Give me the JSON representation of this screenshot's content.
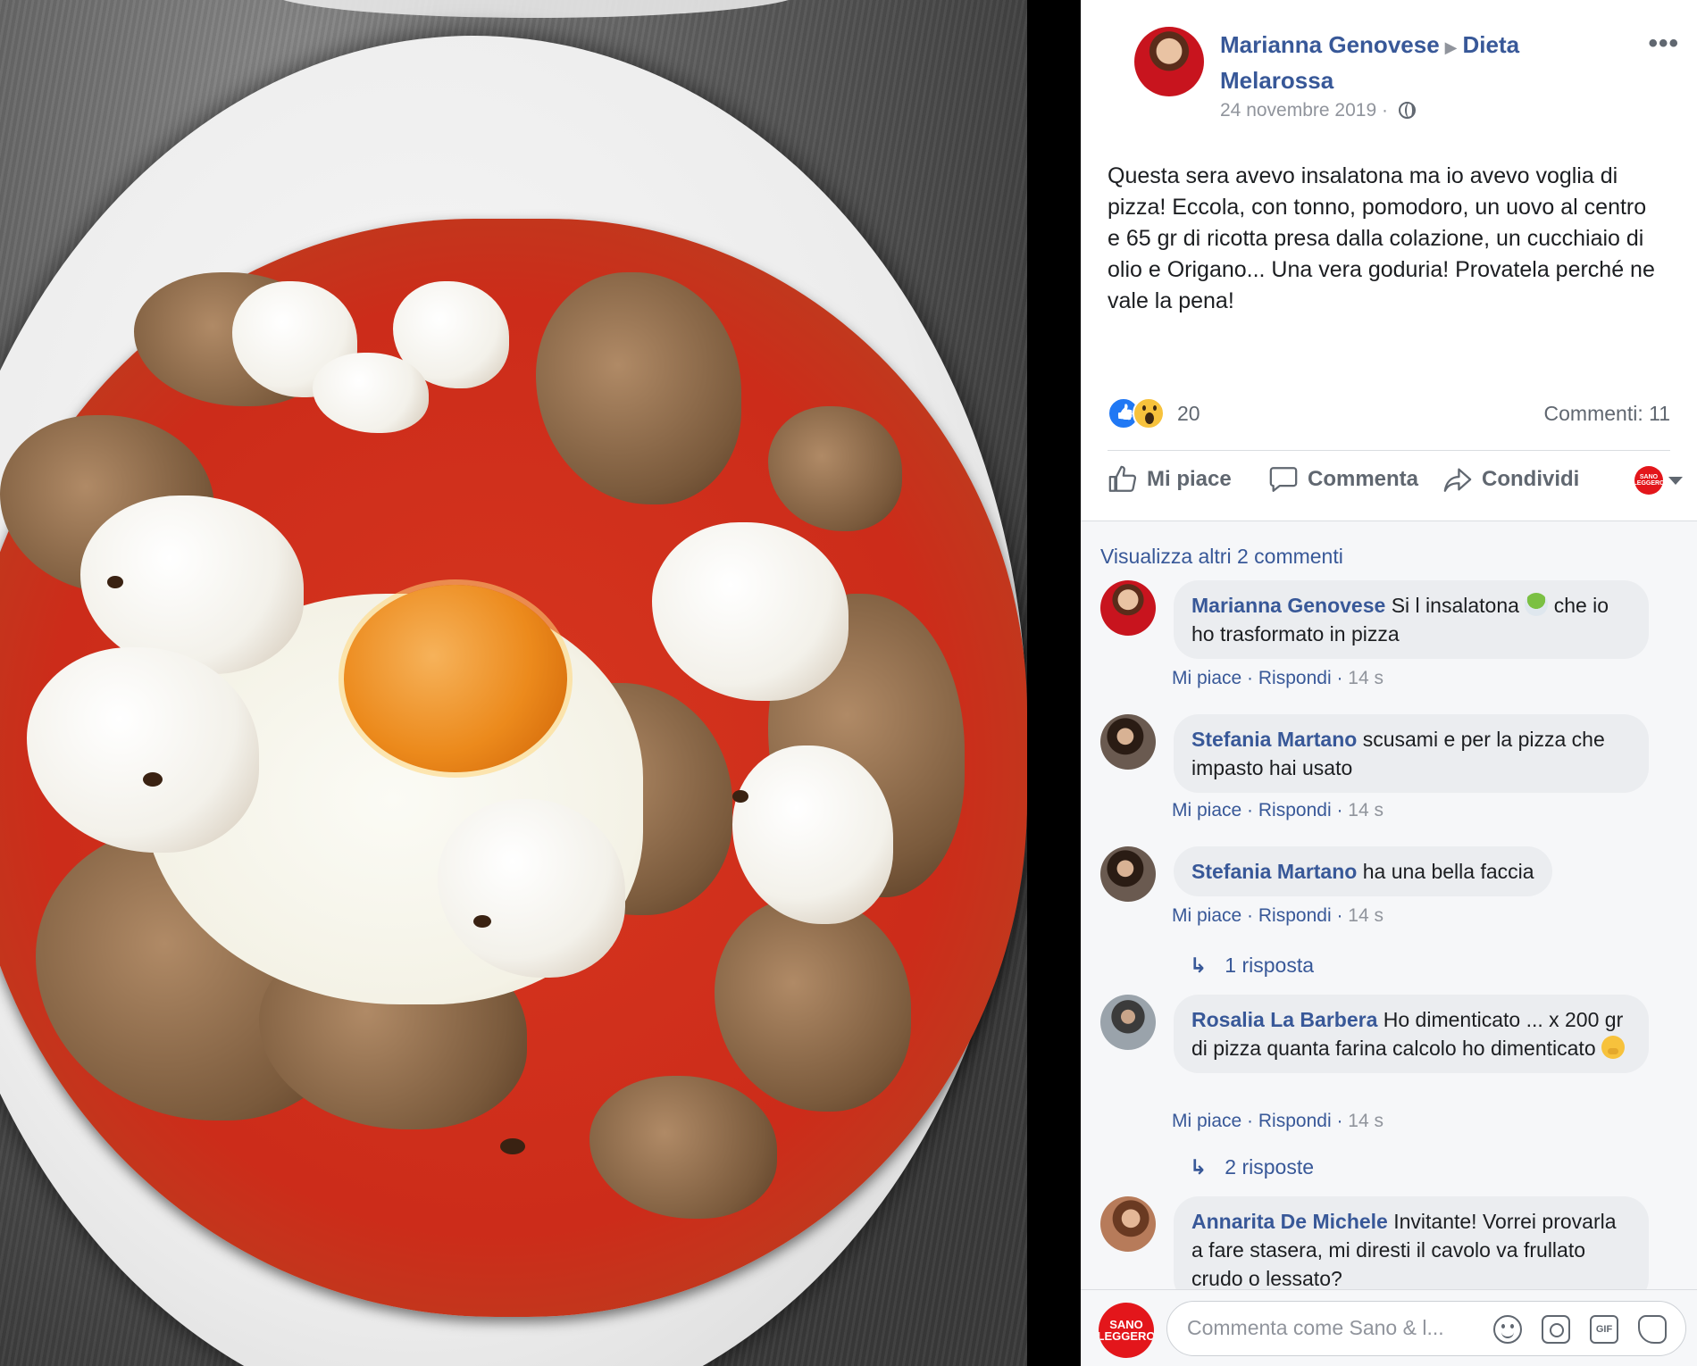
{
  "post": {
    "author": "Marianna Genovese",
    "group": "Dieta Melarossa",
    "date": "24 novembre 2019",
    "privacy_icon": "globe-icon",
    "more_icon": "more-icon",
    "text": "Questa sera avevo insalatona ma io avevo voglia di pizza! Eccola, con tonno, pomodoro, un uovo al centro e 65 gr di ricotta presa dalla colazione, un cucchiaio di olio e Origano... Una vera goduria! Provatela perché ne vale la pena!"
  },
  "reactions": {
    "icons": [
      "like-reaction-icon",
      "wow-reaction-icon"
    ],
    "count": "20",
    "comments_count": "Commenti: 11"
  },
  "actions": {
    "like": "Mi piace",
    "comment": "Commenta",
    "share": "Condividi"
  },
  "brand": {
    "line1": "SANO",
    "line2": "LEGGERO",
    "color": "#e3161b"
  },
  "comments": {
    "view_more": "Visualizza altri 2 commenti",
    "like_label": "Mi piace",
    "reply_label": "Rispondi",
    "separator": "·",
    "items": [
      {
        "author": "Marianna Genovese",
        "text_a": "Si l insalatona",
        "text_b": "che io ho trasformato in pizza",
        "time": "14 s"
      },
      {
        "author": "Stefania Martano",
        "text": "scusami e per la pizza che impasto hai usato",
        "time": "14 s"
      },
      {
        "author": "Stefania Martano",
        "text": "ha una bella faccia",
        "time": "14 s",
        "replies": "1 risposta"
      },
      {
        "author": "Rosalia La Barbera",
        "text": "Ho dimenticato ... x 200 gr di pizza quanta farina calcolo ho dimenticato",
        "time": "14 s",
        "replies": "2 risposte"
      },
      {
        "author": "Annarita De Michele",
        "text": "Invitante! Vorrei provarla a fare stasera, mi diresti il cavolo va frullato crudo o lessato?"
      }
    ]
  },
  "composer": {
    "placeholder": "Commenta come Sano & l...",
    "gif_label": "GIF"
  },
  "colors": {
    "link": "#385898",
    "muted": "#90949c",
    "like_blue": "#2078f4"
  }
}
